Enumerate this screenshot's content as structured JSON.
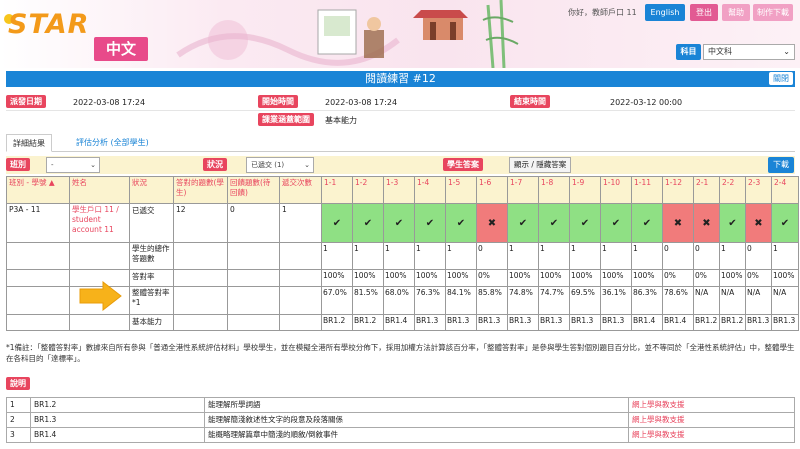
{
  "header": {
    "logo_main": "STAR",
    "logo_sub": "中文",
    "greeting": "你好，教師戶口 11",
    "lang_button": "English",
    "logout_button": "登出",
    "help_button": "幫助",
    "download_button": "制作下載",
    "subject_label": "科目",
    "subject_value": "中文科"
  },
  "title_bar": {
    "title": "閱讀練習 #12",
    "close_label": "關閉"
  },
  "info": {
    "issue_label": "派發日期",
    "issue_value": "2022-03-08 17:24",
    "start_label": "開始時間",
    "start_value": "2022-03-08 17:24",
    "end_label": "結束時間",
    "end_value": "2022-03-12 00:00",
    "scope_label": "課業涵蓋範圍",
    "scope_value": "基本能力"
  },
  "tabs": [
    {
      "label": "詳細結果"
    },
    {
      "label": "評估分析 (全部學生)"
    }
  ],
  "filters": {
    "class_label": "班別",
    "class_value": "-",
    "status_label": "狀況",
    "status_value": "已遞交 (1)",
    "answer_label": "學生答案",
    "show_hide_label": "顯示 / 隱藏答案",
    "download_label": "下載"
  },
  "table": {
    "headers": {
      "class_no": "班別 - 學號 ▲",
      "name": "姓名",
      "status": "狀況",
      "correct": "答對的題數(學生)",
      "answered": "回饋題數(待回饋)",
      "submits": "遞交次數"
    },
    "questions": [
      "1-1",
      "1-2",
      "1-3",
      "1-4",
      "1-5",
      "1-6",
      "1-7",
      "1-8",
      "1-9",
      "1-10",
      "1-11",
      "1-12",
      "2-1",
      "2-2",
      "2-3",
      "2-4"
    ],
    "student": {
      "class_no": "P3A - 11",
      "name": "學生戶口 11 / student account 11",
      "status": "已遞交",
      "correct": "12",
      "answered": "0",
      "submits": "1",
      "marks": [
        true,
        true,
        true,
        true,
        true,
        false,
        true,
        true,
        true,
        true,
        true,
        false,
        false,
        true,
        false,
        true
      ]
    },
    "row_labels": {
      "count": "學生的總作答題數",
      "rate": "答對率",
      "overall": "整體答對率*1",
      "ability": "基本能力"
    },
    "count_values": [
      "1",
      "1",
      "1",
      "1",
      "1",
      "0",
      "1",
      "1",
      "1",
      "1",
      "1",
      "0",
      "0",
      "1",
      "0",
      "1"
    ],
    "rate_values": [
      "100%",
      "100%",
      "100%",
      "100%",
      "100%",
      "0%",
      "100%",
      "100%",
      "100%",
      "100%",
      "100%",
      "0%",
      "0%",
      "100%",
      "0%",
      "100%"
    ],
    "overall_values": [
      "67.0%",
      "81.5%",
      "68.0%",
      "76.3%",
      "84.1%",
      "85.8%",
      "74.8%",
      "74.7%",
      "69.5%",
      "36.1%",
      "86.3%",
      "78.6%",
      "N/A",
      "N/A",
      "N/A",
      "N/A"
    ],
    "ability_values": [
      "BR1.2",
      "BR1.2",
      "BR1.4",
      "BR1.3",
      "BR1.3",
      "BR1.3",
      "BR1.3",
      "BR1.3",
      "BR1.3",
      "BR1.3",
      "BR1.4",
      "BR1.4",
      "BR1.2",
      "BR1.2",
      "BR1.3",
      "BR1.3"
    ]
  },
  "footnote": "*1備註：「整體答對率」數據來自所有參與「普通全港性系統評估材料」學校學生，並在模擬全港所有學校分佈下，採用加權方法計算該百分率，「整體答對率」是參與學生答對個別題目百分比，並不等同於「全港性系統評估」中，整體學生在各科目的「達標率」。",
  "explanation": {
    "label": "說明",
    "rows": [
      {
        "no": "1",
        "code": "BR1.2",
        "desc": "能理解所學詞語",
        "link": "網上學與教支援"
      },
      {
        "no": "2",
        "code": "BR1.3",
        "desc": "能理解簡淺敘述性文字的段意及段落關係",
        "link": "網上學與教支援"
      },
      {
        "no": "3",
        "code": "BR1.4",
        "desc": "能概略理解篇章中簡淺的順敘/倒敘事件",
        "link": "網上學與教支援"
      }
    ]
  }
}
